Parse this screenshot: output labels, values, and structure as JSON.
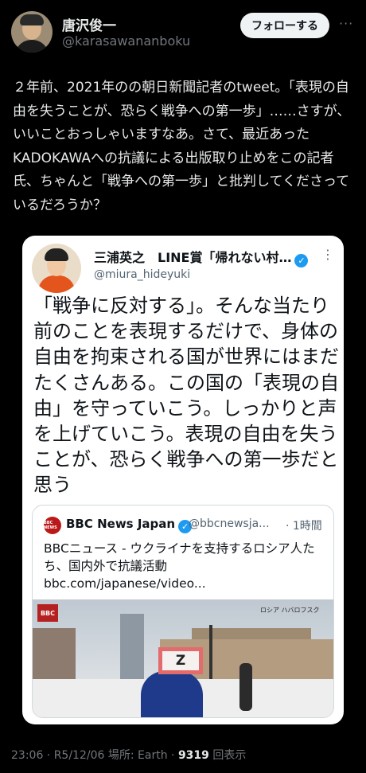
{
  "author": {
    "name": "唐沢俊一",
    "handle": "@karasawananboku",
    "follow_label": "フォローする",
    "more_label": "···"
  },
  "tweet": {
    "text": "２年前、2021年のの朝日新聞記者のtweet。「表現の自由を失うことが、恐らく戦争への第一歩」……さすが、いいことおっしゃいますなあ。さて、最近あったKADOKAWAへの抗議による出版取り止めをこの記者氏、ちゃんと「戦争への第一歩」と批判してくださっているだろうか？"
  },
  "quoted": {
    "name": "三浦英之　LINE賞「帰れない村…",
    "handle": "@miura_hideyuki",
    "verified_icon": "✓",
    "more_label": "⋮",
    "text": "「戦争に反対する」。そんな当たり前のことを表現するだけで、身体の自由を拘束される国が世界にはまだたくさんある。この国の「表現の自由」を守っていこう。しっかりと声を上げていこう。表現の自由を失うことが、恐らく戦争への第一歩だと思う",
    "card": {
      "logo_text": "BBC NEWS",
      "name": "BBC News Japan",
      "verified_icon": "✓",
      "handle": "@bbcnewsja...",
      "time": "· 1時間",
      "text": "BBCニュース - ウクライナを支持するロシア人たち、国内外で抗議活動",
      "link": "bbc.com/japanese/video...",
      "photo_overlay": "BBC",
      "photo_caption": "ロシア ハバロフスク",
      "sign_text": "Z"
    }
  },
  "footer": {
    "time": "23:06 · R5/12/06",
    "location": "場所: Earth",
    "views": "9319",
    "views_label": "回表示"
  },
  "colors": {
    "background": "#000000",
    "follow_button": "#eff3f4",
    "verified": "#1d9bf0",
    "bbc_red": "#bb1919"
  }
}
